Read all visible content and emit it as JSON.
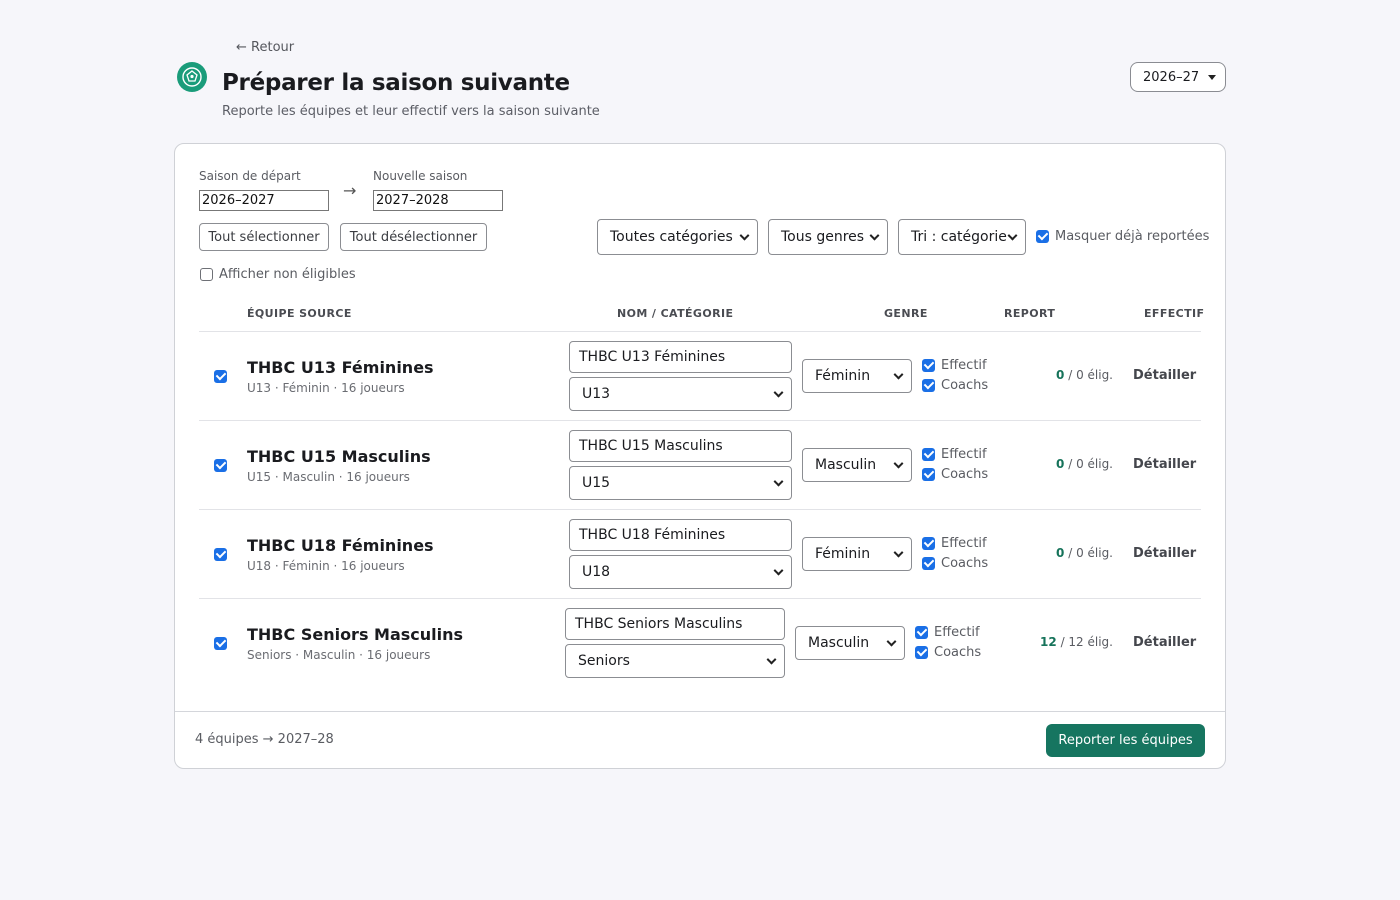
{
  "header": {
    "back_label": "← Retour",
    "title": "Préparer la saison suivante",
    "subtitle": "Reporte les équipes et leur effectif vers la saison suivante",
    "season_selector": "2026–27"
  },
  "form": {
    "source_label": "Saison de départ",
    "source_value": "2026–2027",
    "target_label": "Nouvelle saison",
    "target_value": "2027–2028",
    "arrow": "→",
    "select_all": "Tout sélectionner",
    "deselect_all": "Tout désélectionner",
    "filter_category": "Toutes catégories",
    "filter_gender": "Tous genres",
    "sort": "Tri : catégorie",
    "hide_reported_label": "Masquer déjà reportées",
    "hide_reported_checked": true,
    "show_ineligible_label": "Afficher non éligibles",
    "show_ineligible_checked": false
  },
  "table": {
    "headers": {
      "source": "ÉQUIPE SOURCE",
      "name": "NOM / CATÉGORIE",
      "gender": "GENRE",
      "report": "REPORT",
      "roster": "EFFECTIF"
    },
    "report_effectif": "Effectif",
    "report_coachs": "Coachs",
    "detail_label": "Détailler",
    "rows": [
      {
        "title": "THBC U13 Féminines",
        "sub": "U13 · Féminin · 16 joueurs",
        "name": "THBC U13 Féminines",
        "category": "U13",
        "gender": "Féminin",
        "elig_count": "0",
        "elig_total": " / 0 élig."
      },
      {
        "title": "THBC U15 Masculins",
        "sub": "U15 · Masculin · 16 joueurs",
        "name": "THBC U15 Masculins",
        "category": "U15",
        "gender": "Masculin",
        "elig_count": "0",
        "elig_total": " / 0 élig."
      },
      {
        "title": "THBC U18 Féminines",
        "sub": "U18 · Féminin · 16 joueurs",
        "name": "THBC U18 Féminines",
        "category": "U18",
        "gender": "Féminin",
        "elig_count": "0",
        "elig_total": " / 0 élig."
      },
      {
        "title": "THBC Seniors Masculins",
        "sub": "Seniors · Masculin · 16 joueurs",
        "name": "THBC Seniors Masculins",
        "category": "Seniors",
        "gender": "Masculin",
        "elig_count": "12",
        "elig_total": " / 12 élig."
      }
    ]
  },
  "footer": {
    "summary": "4 équipes → 2027–28",
    "submit": "Reporter les équipes"
  },
  "colors": {
    "accent": "#167560",
    "checkbox": "#1a6fe6",
    "background": "#f6f6fa"
  }
}
